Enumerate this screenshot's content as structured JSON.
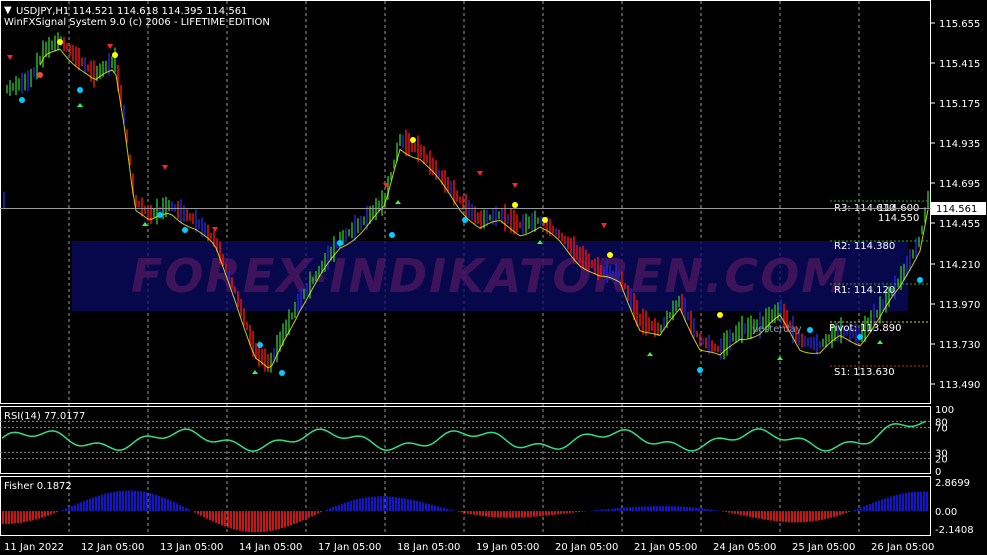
{
  "header": {
    "symbol_line": "USDJPY,H1  114.521 114.618 114.395 114.561",
    "indicator_title": "WinFXSignal System 9.0 (c) 2006 - LIFETIME EDITION"
  },
  "watermark": "FOREX-INDIKATOREN.COM",
  "current_price": "114.561",
  "price_axis": [
    "115.655",
    "115.415",
    "115.175",
    "114.935",
    "114.695",
    "114.455",
    "114.210",
    "113.970",
    "113.730",
    "113.490"
  ],
  "levels": {
    "r3": "R3: 114.610",
    "r3_overlap_a": "114.600",
    "r3_overlap_b": "114.550",
    "r2": "R2: 114.380",
    "r1": "R1: 114.120",
    "yesterday": "yesterday",
    "pivot": "Pivot: 113.890",
    "s1": "S1: 113.630"
  },
  "rsi": {
    "label": "RSI(14) 77.0177",
    "axis": [
      "100",
      "80",
      "70",
      "30",
      "20",
      "0"
    ]
  },
  "fisher": {
    "label": "Fisher 0.1872",
    "axis": [
      "2.8699",
      "0.00",
      "-2.1408"
    ]
  },
  "time_axis": [
    "11 Jan 2022",
    "12 Jan 05:00",
    "13 Jan 05:00",
    "14 Jan 05:00",
    "17 Jan 05:00",
    "18 Jan 05:00",
    "19 Jan 05:00",
    "20 Jan 05:00",
    "21 Jan 05:00",
    "24 Jan 05:00",
    "25 Jan 05:00",
    "26 Jan 05:00"
  ],
  "colors": {
    "background": "#000000",
    "bull": "#22aa22",
    "bear": "#dd1111",
    "neutral": "#2222cc",
    "rsi_line": "#33dd88",
    "fisher_pos": "#1a1aff",
    "fisher_neg": "#ff1a1a",
    "signal_line": "#ffff00",
    "grid": "#ffffff"
  }
}
